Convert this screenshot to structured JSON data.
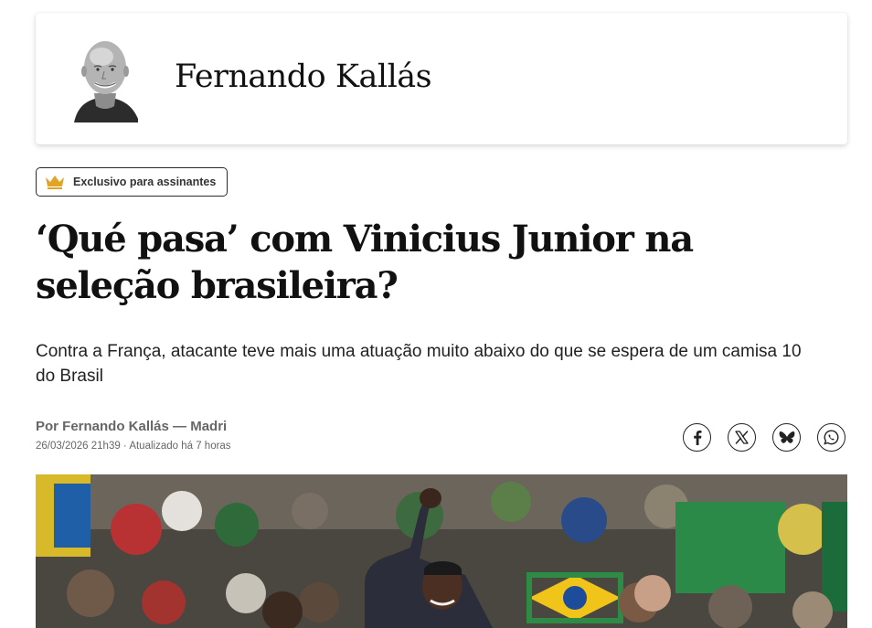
{
  "author_card": {
    "name": "Fernando Kallás",
    "avatar": "author-portrait"
  },
  "badge": {
    "label": "Exclusivo para assinantes",
    "icon": "crown-icon",
    "icon_color": "#e0a526"
  },
  "article": {
    "headline": "‘Qué pasa’ com Vinicius Junior na seleção brasileira?",
    "subtitle": "Contra a França, atacante teve mais uma atuação muito abaixo do que se espera de um camisa 10 do Brasil",
    "byline": "Por Fernando Kallás — Madri",
    "dateline": "26/03/2026 21h39 · Atualizado há 7 horas"
  },
  "share": [
    {
      "icon": "facebook-icon"
    },
    {
      "icon": "x-icon"
    },
    {
      "icon": "bluesky-icon"
    },
    {
      "icon": "whatsapp-icon"
    }
  ],
  "photo": {
    "subject": "stadium-crowd-celebration"
  }
}
